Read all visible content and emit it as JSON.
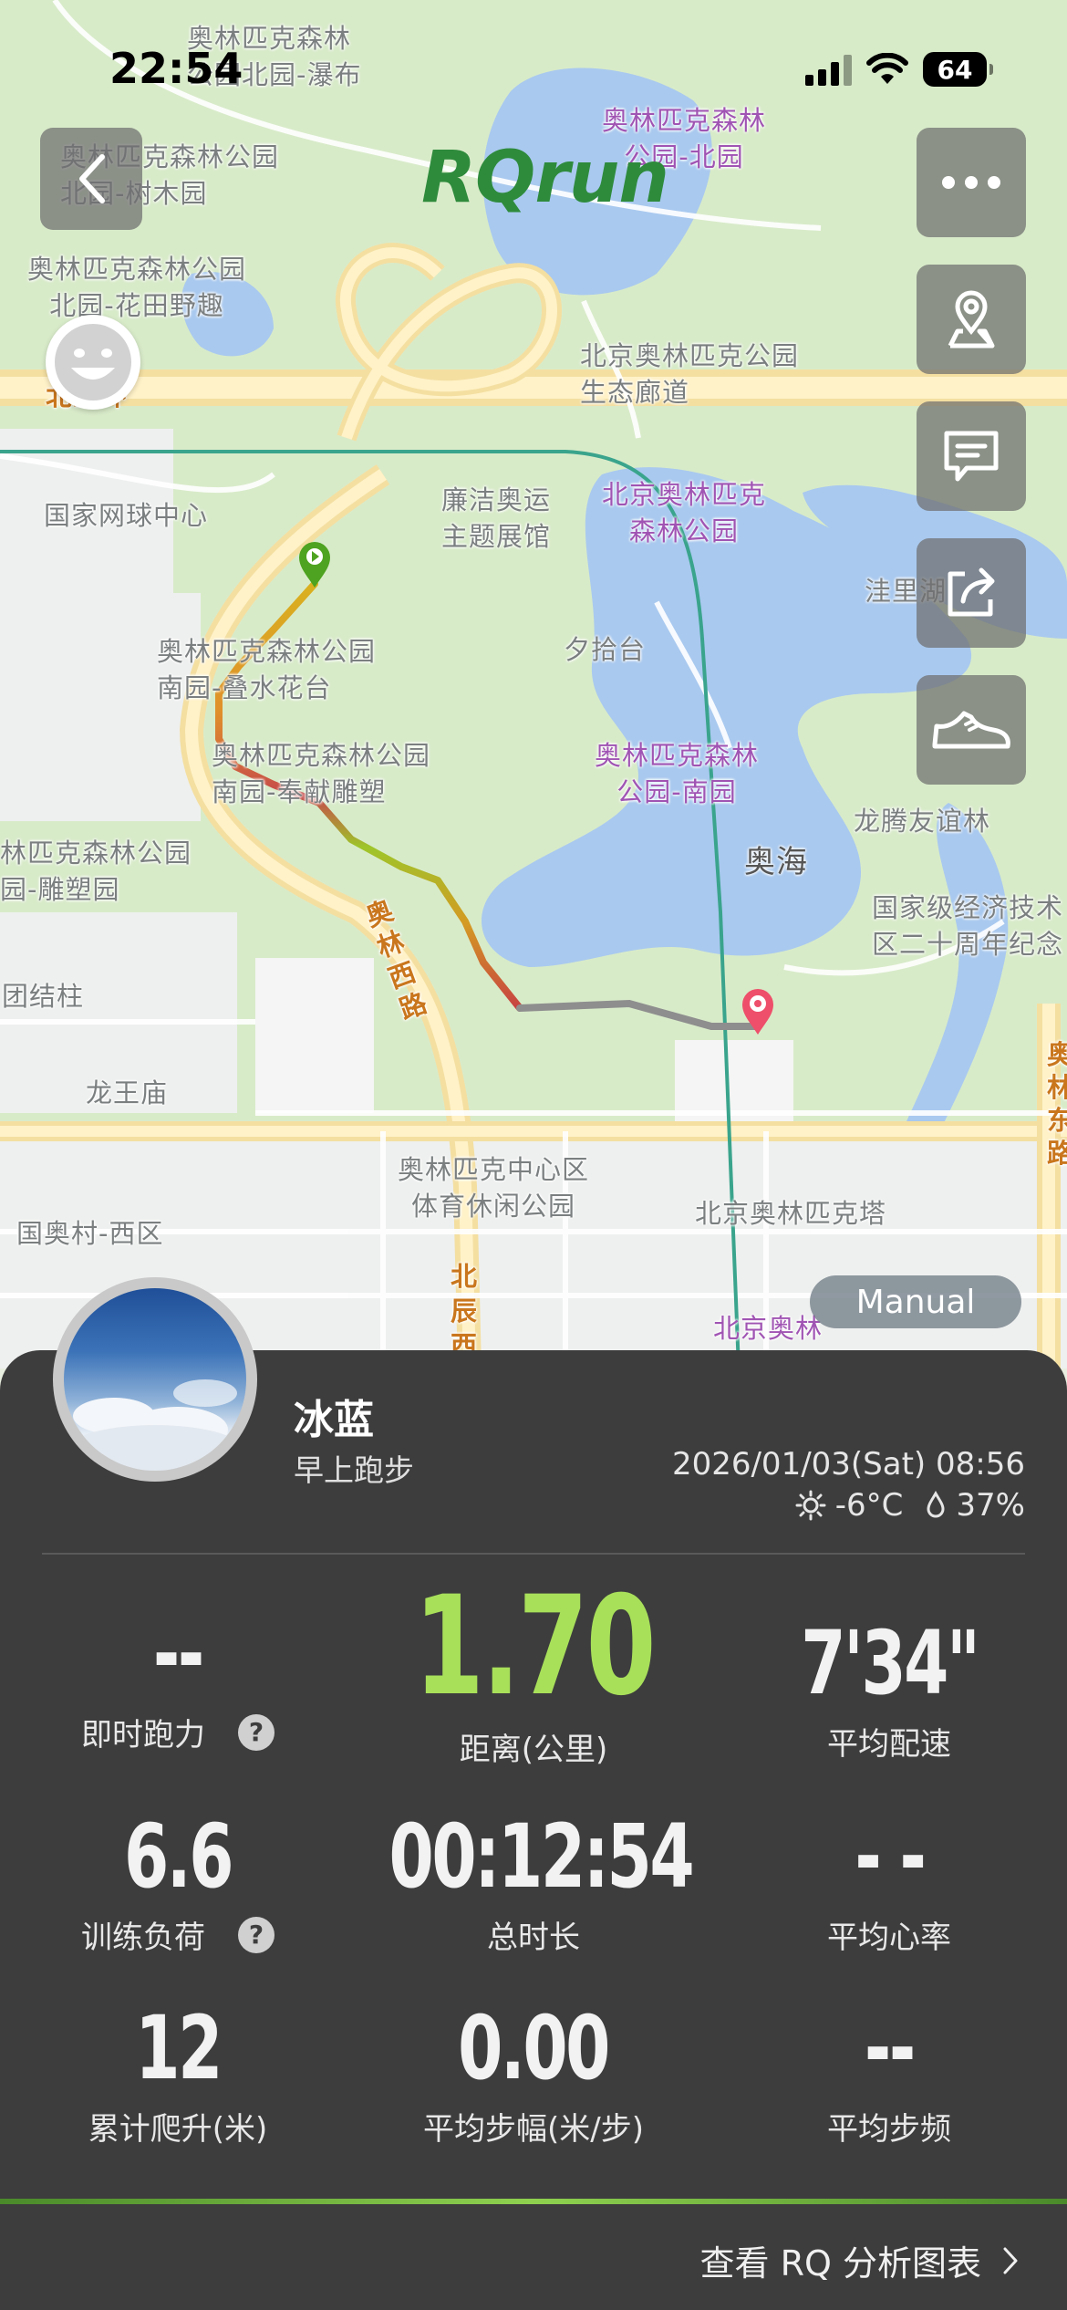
{
  "status_bar": {
    "time": "22:54",
    "battery": "64"
  },
  "map": {
    "logo": "RQrun",
    "labels": [
      {
        "text": "奥林匹克森林\n公园北园-瀑布",
        "style": ""
      },
      {
        "text": "奥林匹克森林\n公园-北园",
        "style": "purple"
      },
      {
        "text": "奥林匹克森林公园\n北园-树木园",
        "style": ""
      },
      {
        "text": "奥林匹克森林公园\n北园-花田野趣",
        "style": ""
      },
      {
        "text": "北京奥林匹克公园\n生态廊道",
        "style": ""
      },
      {
        "text": "北五环",
        "style": "orange"
      },
      {
        "text": "国家网球中心",
        "style": ""
      },
      {
        "text": "廉洁奥运\n主题展馆",
        "style": ""
      },
      {
        "text": "北京奥林匹克\n森林公园",
        "style": "purple"
      },
      {
        "text": "洼里湖",
        "style": ""
      },
      {
        "text": "奥林匹克森林公园\n南园-叠水花台",
        "style": ""
      },
      {
        "text": "夕拾台",
        "style": ""
      },
      {
        "text": "奥林匹克森林公园\n南园-奉献雕塑",
        "style": ""
      },
      {
        "text": "奥林匹克森林\n公园-南园",
        "style": "purple"
      },
      {
        "text": "龙腾友谊林",
        "style": ""
      },
      {
        "text": "林匹克森林公园\n园-雕塑园",
        "style": ""
      },
      {
        "text": "奥海",
        "style": "dark"
      },
      {
        "text": "国家级经济技术\n区二十周年纪念",
        "style": ""
      },
      {
        "text": "团结柱",
        "style": ""
      },
      {
        "text": "奥\n林\n西\n路",
        "style": "orange"
      },
      {
        "text": "龙王庙",
        "style": ""
      },
      {
        "text": "奥林匹克中心区\n体育休闲公园",
        "style": ""
      },
      {
        "text": "北京奥林匹克塔",
        "style": ""
      },
      {
        "text": "国奥村-西区",
        "style": ""
      },
      {
        "text": "北\n辰\n西",
        "style": "orange"
      },
      {
        "text": "北京奥林",
        "style": "purple"
      },
      {
        "text": "奥\n林\n东\n路",
        "style": "orange"
      }
    ],
    "manual_label": "Manual"
  },
  "activity": {
    "user_name": "冰蓝",
    "type": "早上跑步",
    "date_time": "2026/01/03(Sat) 08:56",
    "temperature": "-6°C",
    "humidity": "37%"
  },
  "metrics": [
    {
      "value": "--",
      "label": "即时跑力",
      "help": "?"
    },
    {
      "value": "1.70",
      "label": "距离(公里)"
    },
    {
      "value": "7'34\"",
      "label": "平均配速"
    },
    {
      "value": "6.6",
      "label": "训练负荷",
      "help": "?"
    },
    {
      "value": "00:12:54",
      "label": "总时长"
    },
    {
      "value": "- -",
      "label": "平均心率"
    },
    {
      "value": "12",
      "label": "累计爬升(米)"
    },
    {
      "value": "0.00",
      "label": "平均步幅(米/步)"
    },
    {
      "value": "--",
      "label": "平均步频"
    }
  ],
  "footer": {
    "analysis_link": "查看 RQ 分析图表"
  },
  "colors": {
    "accent": "#a8e05a",
    "panel": "#3d3d3d",
    "route_start": "#5aa91f",
    "route_end": "#ee4f6a"
  }
}
